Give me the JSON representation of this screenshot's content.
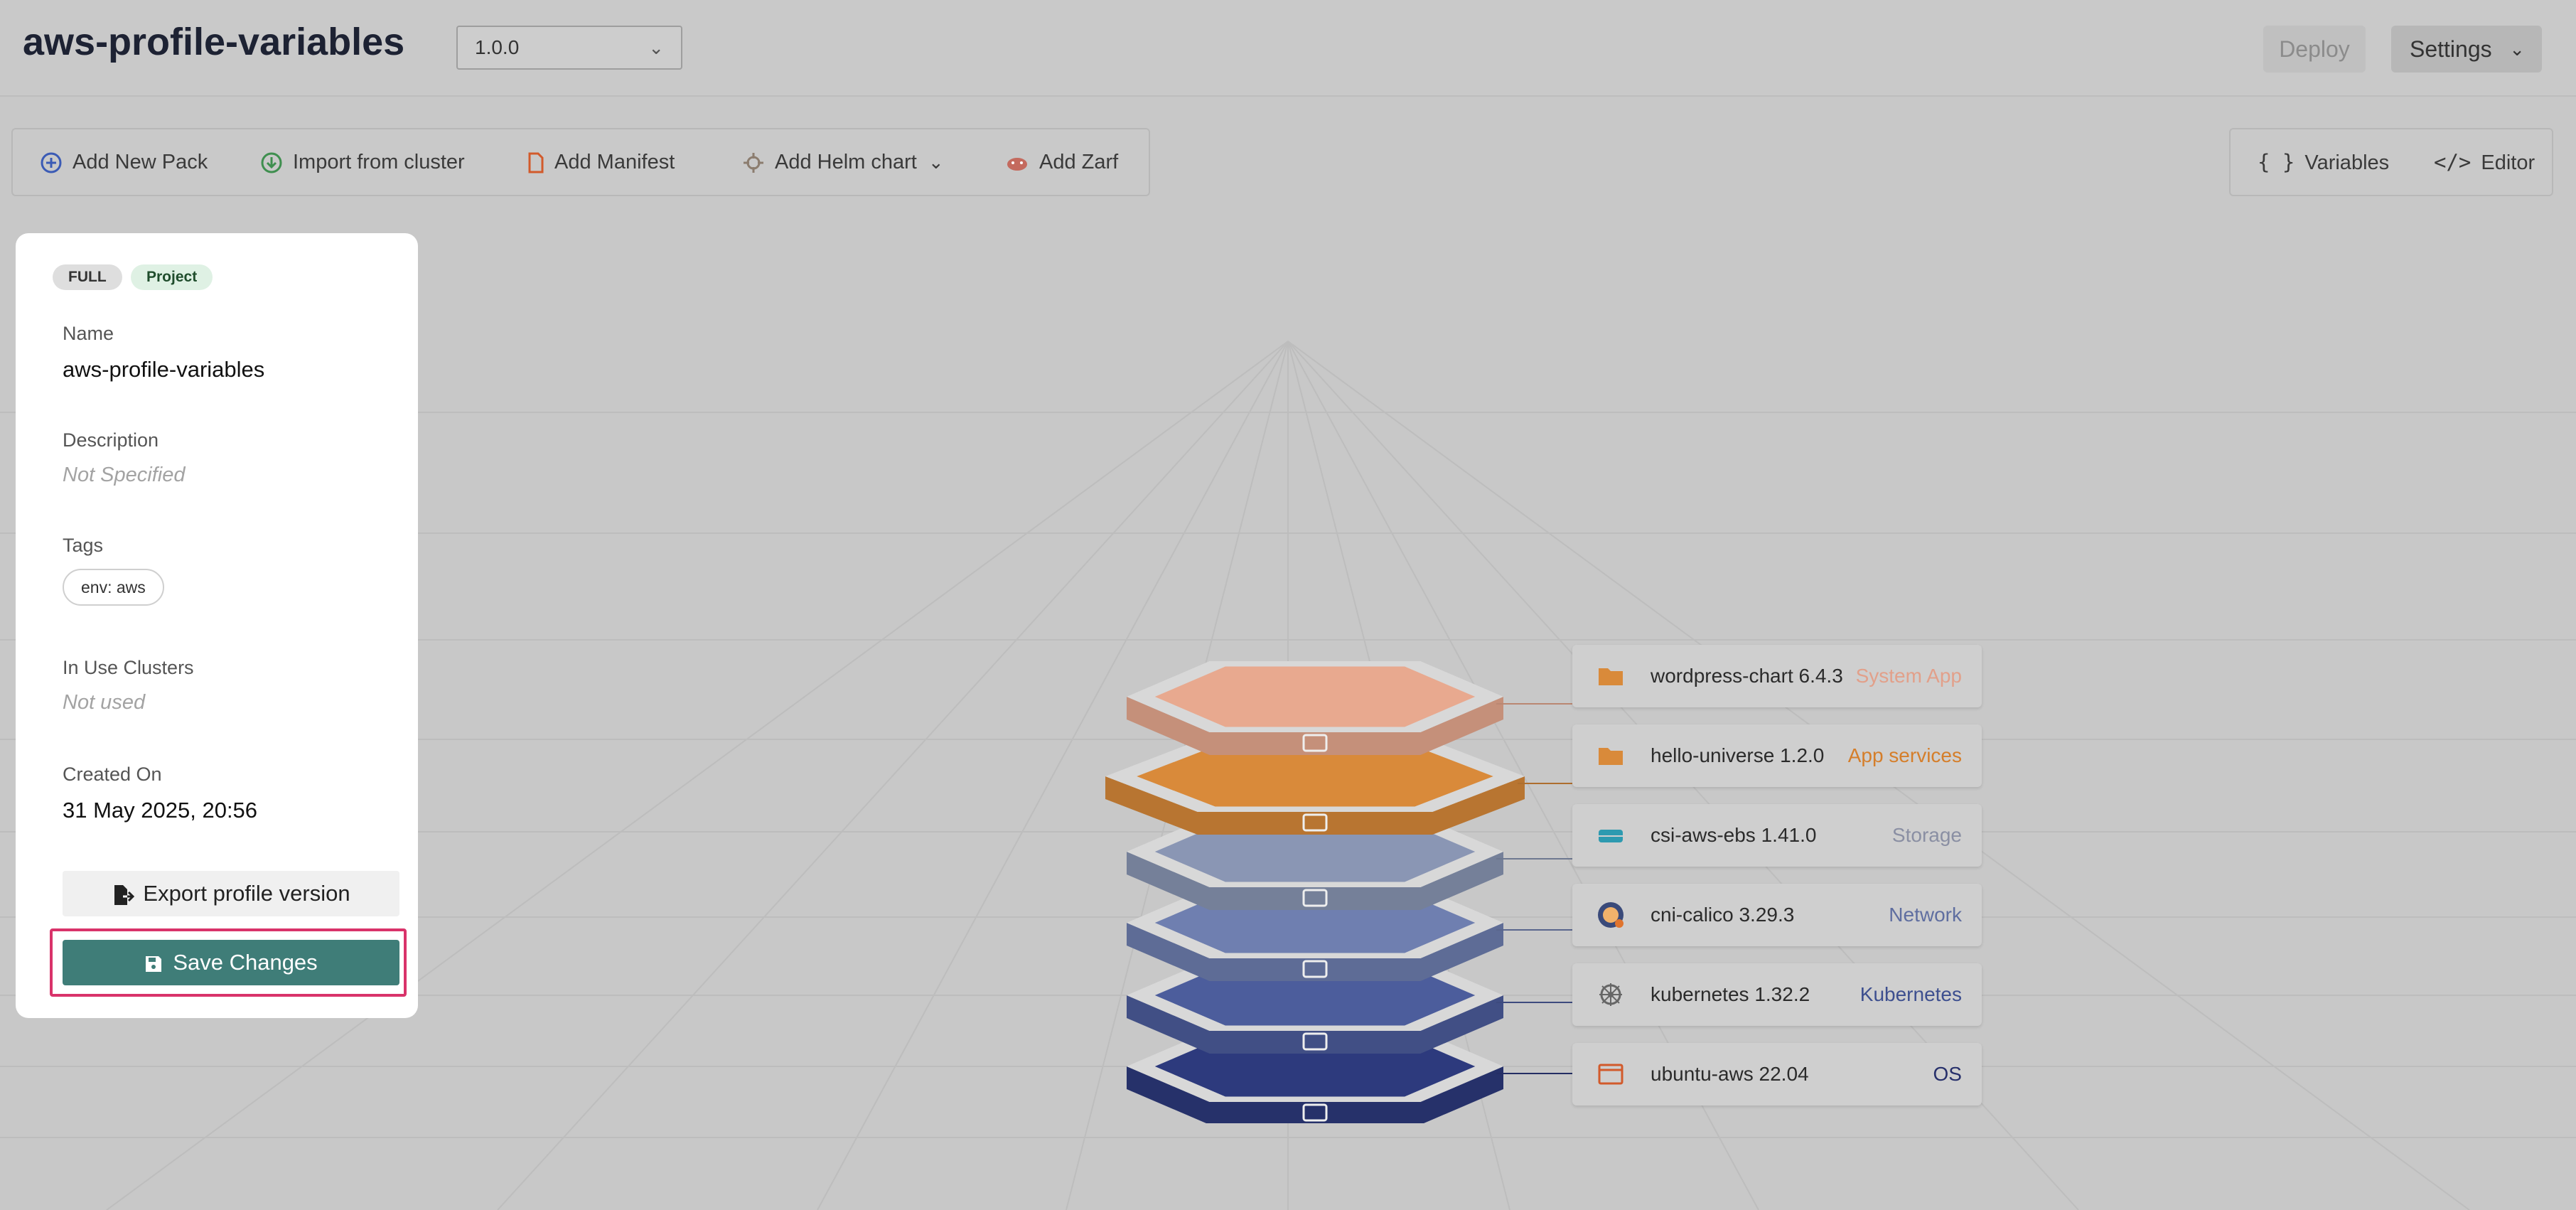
{
  "header": {
    "title": "aws-profile-variables",
    "version": "1.0.0",
    "deploy_label": "Deploy",
    "settings_label": "Settings"
  },
  "toolbar": {
    "add_pack": "Add New Pack",
    "import_cluster": "Import from cluster",
    "add_manifest": "Add Manifest",
    "add_helm": "Add Helm chart",
    "add_zarf": "Add Zarf",
    "variables": "Variables",
    "editor": "Editor"
  },
  "panel": {
    "badges": [
      "FULL",
      "Project"
    ],
    "name_label": "Name",
    "name_value": "aws-profile-variables",
    "description_label": "Description",
    "description_value": "Not Specified",
    "tags_label": "Tags",
    "tags": [
      "env: aws"
    ],
    "in_use_label": "In Use Clusters",
    "in_use_value": "Not used",
    "created_label": "Created On",
    "created_value": "31 May 2025, 20:56",
    "export_label": "Export profile version",
    "save_label": "Save Changes"
  },
  "layers": [
    {
      "name": "wordpress-chart 6.4.3",
      "type": "System App",
      "color": "#e8a98f",
      "icon": "folder-icon"
    },
    {
      "name": "hello-universe 1.2.0",
      "type": "App services",
      "color": "#d98a3a",
      "icon": "folder-icon"
    },
    {
      "name": "csi-aws-ebs 1.41.0",
      "type": "Storage",
      "color": "#8a96b4",
      "icon": "storage-icon"
    },
    {
      "name": "cni-calico 3.29.3",
      "type": "Network",
      "color": "#6f7fb0",
      "icon": "calico-icon"
    },
    {
      "name": "kubernetes 1.32.2",
      "type": "Kubernetes",
      "color": "#4c5d9c",
      "icon": "kubernetes-icon"
    },
    {
      "name": "ubuntu-aws 22.04",
      "type": "OS",
      "color": "#2d3a7d",
      "icon": "window-icon"
    }
  ],
  "colors": {
    "accent": "#3f7d78",
    "highlight": "#d9336a"
  }
}
